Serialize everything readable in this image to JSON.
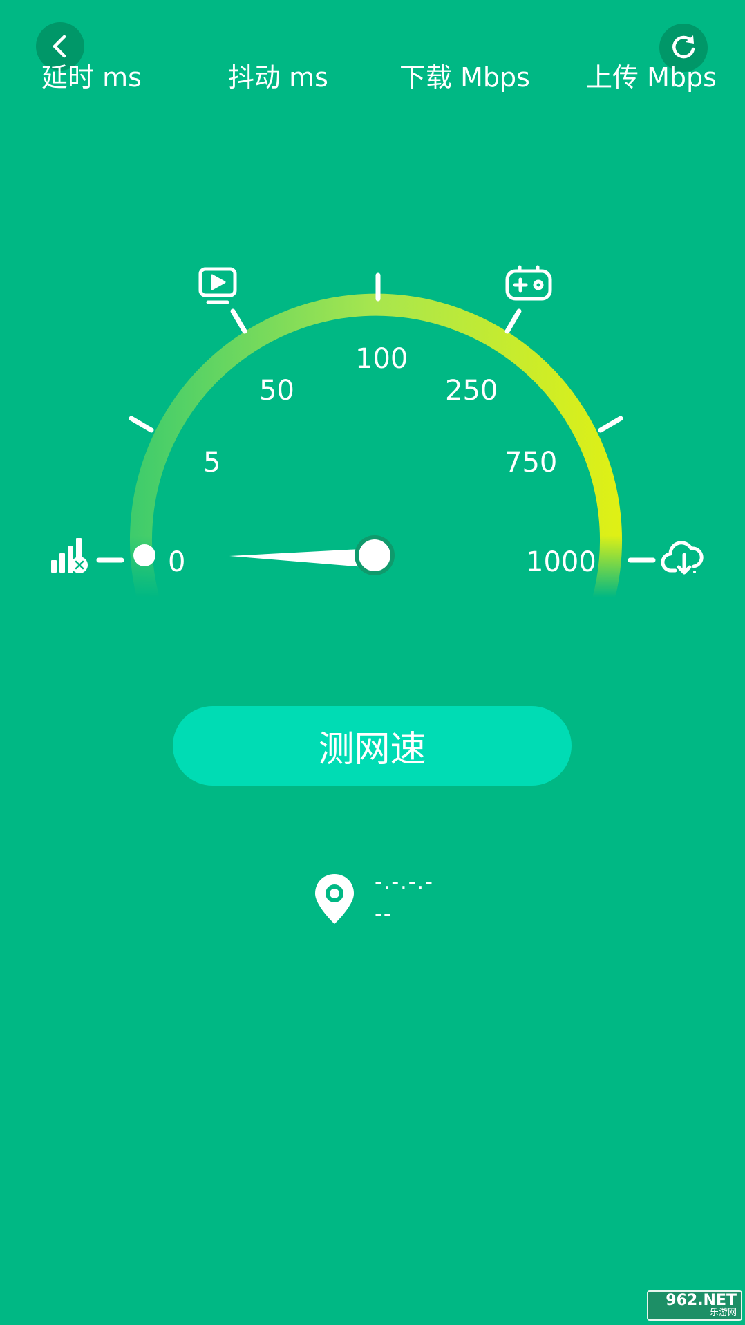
{
  "header": {
    "metrics": [
      {
        "label": "延时 ms"
      },
      {
        "label": "抖动 ms"
      },
      {
        "label": "下载 Mbps"
      },
      {
        "label": "上传 Mbps"
      }
    ]
  },
  "gauge": {
    "scale_labels": [
      "0",
      "5",
      "50",
      "100",
      "250",
      "750",
      "1000"
    ],
    "current_value": 0,
    "arc_colors": [
      "#3ecc6c",
      "#a8e64e",
      "#dff015"
    ]
  },
  "actions": {
    "test_label": "测网速"
  },
  "location": {
    "line1": "-.-.-.-",
    "line2": "--"
  },
  "watermark": {
    "top": "962.NET",
    "bottom": "乐游网"
  },
  "icons": {
    "back": "chevron-left-icon",
    "refresh": "refresh-icon",
    "video": "video-play-icon",
    "game": "gamepad-icon",
    "signal": "signal-off-icon",
    "download": "cloud-download-icon",
    "location": "location-pin-icon"
  }
}
